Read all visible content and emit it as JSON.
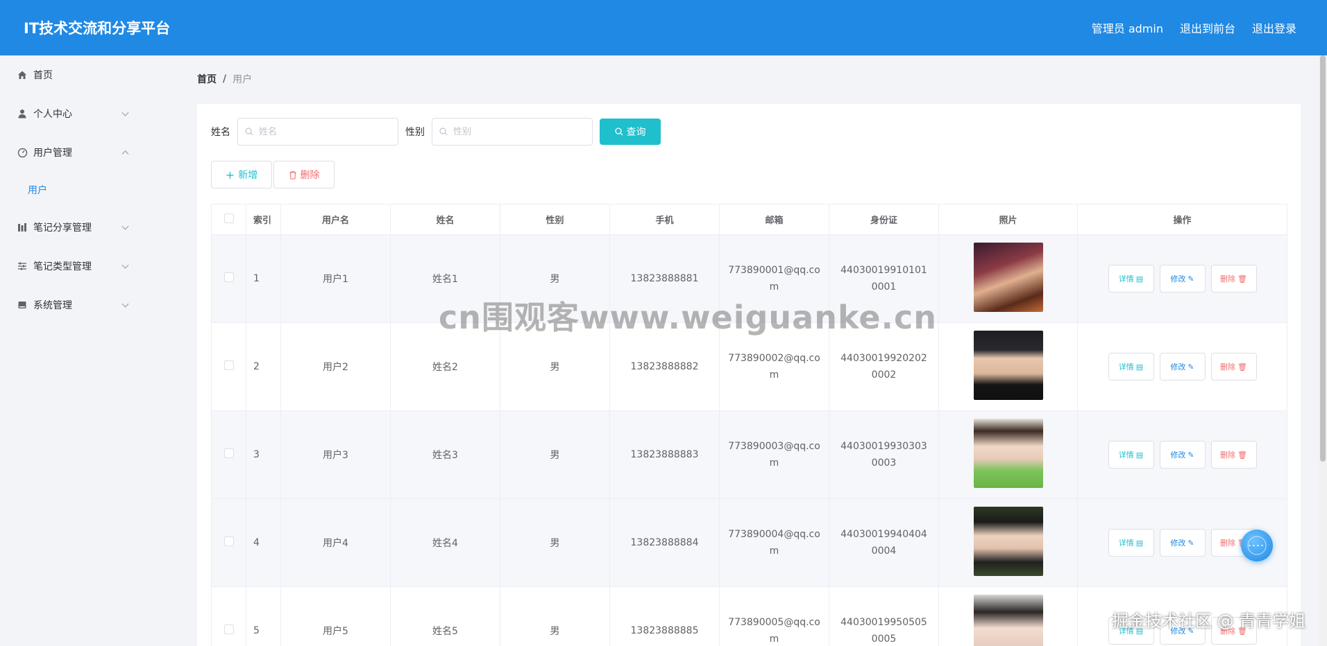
{
  "app": {
    "title": "IT技术交流和分享平台"
  },
  "header": {
    "admin_label": "管理员 admin",
    "front_label": "退出到前台",
    "logout_label": "退出登录"
  },
  "sidebar": {
    "items": [
      {
        "label": "首页",
        "icon": "home-icon"
      },
      {
        "label": "个人中心",
        "icon": "user-icon"
      },
      {
        "label": "用户管理",
        "icon": "gauge-icon"
      },
      {
        "label": "笔记分享管理",
        "icon": "bar-chart-icon"
      },
      {
        "label": "笔记类型管理",
        "icon": "sliders-icon"
      },
      {
        "label": "系统管理",
        "icon": "disk-icon"
      }
    ],
    "sub_active": "用户"
  },
  "breadcrumb": {
    "home": "首页",
    "separator": "/",
    "current": "用户"
  },
  "search": {
    "name_label": "姓名",
    "name_placeholder": "姓名",
    "gender_label": "性别",
    "gender_placeholder": "性别",
    "query_label": "查询"
  },
  "actions": {
    "add_label": "新增",
    "delete_label": "删除"
  },
  "table": {
    "headers": [
      "索引",
      "用户名",
      "姓名",
      "性别",
      "手机",
      "邮箱",
      "身份证",
      "照片",
      "操作"
    ],
    "rows": [
      {
        "index": "1",
        "username": "用户1",
        "name": "姓名1",
        "gender": "男",
        "phone": "13823888881",
        "email": "773890001@qq.com",
        "id_card": "440300199101010001"
      },
      {
        "index": "2",
        "username": "用户2",
        "name": "姓名2",
        "gender": "男",
        "phone": "13823888882",
        "email": "773890002@qq.com",
        "id_card": "440300199202020002"
      },
      {
        "index": "3",
        "username": "用户3",
        "name": "姓名3",
        "gender": "男",
        "phone": "13823888883",
        "email": "773890003@qq.com",
        "id_card": "440300199303030003"
      },
      {
        "index": "4",
        "username": "用户4",
        "name": "姓名4",
        "gender": "男",
        "phone": "13823888884",
        "email": "773890004@qq.com",
        "id_card": "440300199404040004"
      },
      {
        "index": "5",
        "username": "用户5",
        "name": "姓名5",
        "gender": "男",
        "phone": "13823888885",
        "email": "773890005@qq.com",
        "id_card": "440300199505050005"
      }
    ],
    "op_detail": "详情",
    "op_edit": "修改",
    "op_delete": "删除"
  },
  "overlay": {
    "watermark": "cn围观客www.weiguanke.cn",
    "credit": "掘金技术社区 @ 青青学姐"
  },
  "colors": {
    "primary": "#2089e4",
    "cyan": "#1fbfcd",
    "danger": "#f56c6c",
    "bg": "#f2f4f8"
  }
}
